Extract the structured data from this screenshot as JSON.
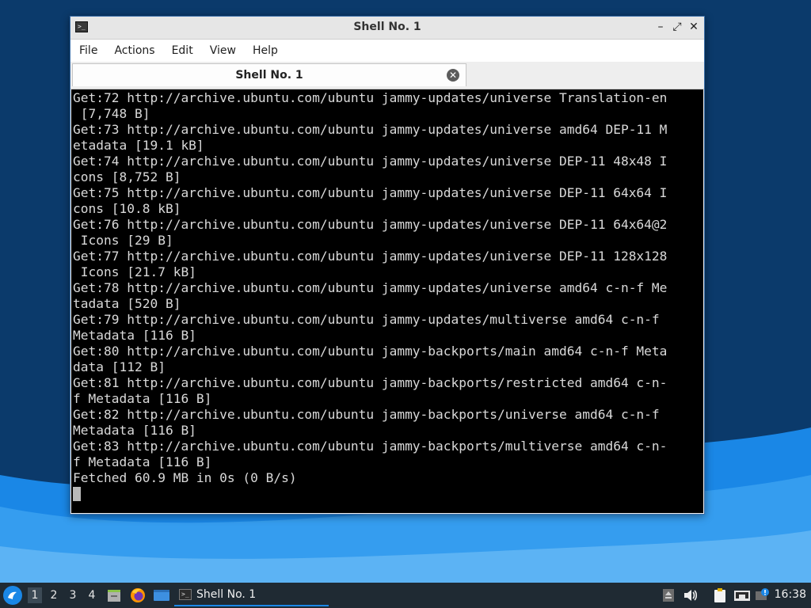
{
  "window": {
    "title": "Shell No. 1",
    "minimize_glyph": "–",
    "maximize_glyph": "⤢",
    "close_glyph": "✕"
  },
  "menubar": {
    "items": [
      {
        "label": "File"
      },
      {
        "label": "Actions"
      },
      {
        "label": "Edit"
      },
      {
        "label": "View"
      },
      {
        "label": "Help"
      }
    ]
  },
  "tabs": [
    {
      "label": "Shell No. 1",
      "close_glyph": "✕"
    }
  ],
  "terminal": {
    "lines": [
      "Get:72 http://archive.ubuntu.com/ubuntu jammy-updates/universe Translation-en",
      " [7,748 B]",
      "Get:73 http://archive.ubuntu.com/ubuntu jammy-updates/universe amd64 DEP-11 M",
      "etadata [19.1 kB]",
      "Get:74 http://archive.ubuntu.com/ubuntu jammy-updates/universe DEP-11 48x48 I",
      "cons [8,752 B]",
      "Get:75 http://archive.ubuntu.com/ubuntu jammy-updates/universe DEP-11 64x64 I",
      "cons [10.8 kB]",
      "Get:76 http://archive.ubuntu.com/ubuntu jammy-updates/universe DEP-11 64x64@2",
      " Icons [29 B]",
      "Get:77 http://archive.ubuntu.com/ubuntu jammy-updates/universe DEP-11 128x128",
      " Icons [21.7 kB]",
      "Get:78 http://archive.ubuntu.com/ubuntu jammy-updates/universe amd64 c-n-f Me",
      "tadata [520 B]",
      "Get:79 http://archive.ubuntu.com/ubuntu jammy-updates/multiverse amd64 c-n-f",
      "Metadata [116 B]",
      "Get:80 http://archive.ubuntu.com/ubuntu jammy-backports/main amd64 c-n-f Meta",
      "data [112 B]",
      "Get:81 http://archive.ubuntu.com/ubuntu jammy-backports/restricted amd64 c-n-",
      "f Metadata [116 B]",
      "Get:82 http://archive.ubuntu.com/ubuntu jammy-backports/universe amd64 c-n-f",
      "Metadata [116 B]",
      "Get:83 http://archive.ubuntu.com/ubuntu jammy-backports/multiverse amd64 c-n-",
      "f Metadata [116 B]",
      "Fetched 60.9 MB in 0s (0 B/s)"
    ]
  },
  "taskbar": {
    "start_icon": "lubuntu-logo-icon",
    "workspaces": [
      "1",
      "2",
      "3",
      "4"
    ],
    "active_workspace": "1",
    "launchers": [
      "file-manager-icon",
      "firefox-icon",
      "show-desktop-icon"
    ],
    "tasks": [
      {
        "label": "Shell No. 1",
        "icon": "terminal-icon"
      }
    ],
    "tray_icons": [
      "usb-eject-icon",
      "volume-icon",
      "clipboard-icon",
      "network-icon",
      "update-notifier-icon"
    ],
    "clock": "16:38"
  },
  "colors": {
    "terminal_bg": "#000000",
    "terminal_fg": "#d9d9d9",
    "accent": "#1a87e6",
    "taskbar_bg": "#1f2a33"
  }
}
